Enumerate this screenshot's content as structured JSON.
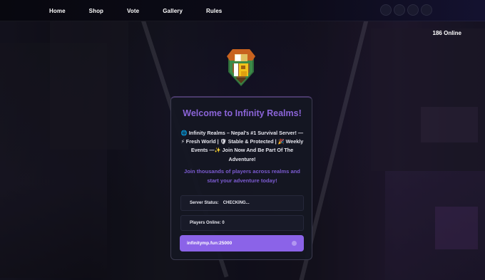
{
  "nav": {
    "links": [
      "Home",
      "Shop",
      "Vote",
      "Gallery",
      "Rules"
    ],
    "social_icons": [
      "discord-icon",
      "youtube-icon",
      "tiktok-icon",
      "instagram-icon"
    ]
  },
  "online_count": "186 Online",
  "card": {
    "title": "Welcome to Infinity Realms!",
    "description": "🌐 Infinity Realms – Nepal's #1 Survival Server! — ⚡ Fresh World | 🛡 Stable & Protected | 🎉 Weekly Events —✨ Join Now And Be Part Of The Adventure!",
    "tagline": "Join thousands of players across realms and start your adventure today!",
    "server_status_label": "Server Status:",
    "server_status_value": "CHECKING...",
    "players_online": "Players Online: 0",
    "server_ip": "infinitymp.fun:25000"
  },
  "colors": {
    "accent": "#8b63e8",
    "title": "#8b64d8",
    "card_bg": "#14161f"
  }
}
